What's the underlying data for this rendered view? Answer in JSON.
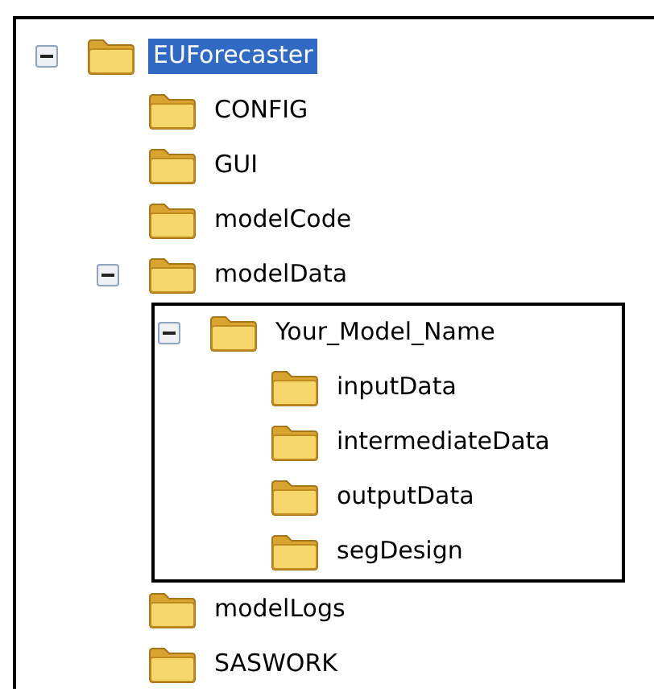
{
  "tree": [
    {
      "name": "EUForecaster",
      "selected": true,
      "outlined": false,
      "expanded": true,
      "children": [
        {
          "name": "CONFIG",
          "selected": false,
          "outlined": false
        },
        {
          "name": "GUI",
          "selected": false,
          "outlined": false
        },
        {
          "name": "modelCode",
          "selected": false,
          "outlined": false
        },
        {
          "name": "modelData",
          "selected": false,
          "outlined": false,
          "expanded": true,
          "children": [
            {
              "name": "Your_Model_Name",
              "selected": false,
              "outlined": true,
              "expanded": true,
              "children": [
                {
                  "name": "inputData",
                  "selected": false,
                  "outlined": false
                },
                {
                  "name": "intermediateData",
                  "selected": false,
                  "outlined": false
                },
                {
                  "name": "outputData",
                  "selected": false,
                  "outlined": false
                },
                {
                  "name": "segDesign",
                  "selected": false,
                  "outlined": false
                }
              ]
            }
          ]
        },
        {
          "name": "modelLogs",
          "selected": false,
          "outlined": false
        },
        {
          "name": "SASWORK",
          "selected": false,
          "outlined": false
        }
      ]
    }
  ]
}
